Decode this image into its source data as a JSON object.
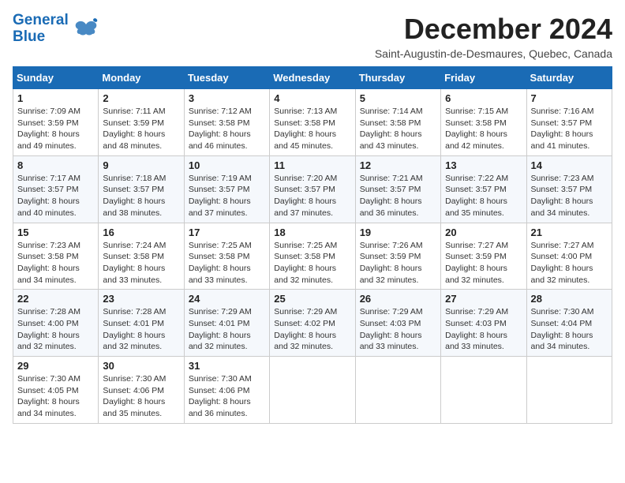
{
  "header": {
    "logo_line1": "General",
    "logo_line2": "Blue",
    "main_title": "December 2024",
    "subtitle": "Saint-Augustin-de-Desmaures, Quebec, Canada"
  },
  "days_of_week": [
    "Sunday",
    "Monday",
    "Tuesday",
    "Wednesday",
    "Thursday",
    "Friday",
    "Saturday"
  ],
  "weeks": [
    [
      {
        "day": "1",
        "sunrise": "7:09 AM",
        "sunset": "3:59 PM",
        "daylight": "8 hours and 49 minutes."
      },
      {
        "day": "2",
        "sunrise": "7:11 AM",
        "sunset": "3:59 PM",
        "daylight": "8 hours and 48 minutes."
      },
      {
        "day": "3",
        "sunrise": "7:12 AM",
        "sunset": "3:58 PM",
        "daylight": "8 hours and 46 minutes."
      },
      {
        "day": "4",
        "sunrise": "7:13 AM",
        "sunset": "3:58 PM",
        "daylight": "8 hours and 45 minutes."
      },
      {
        "day": "5",
        "sunrise": "7:14 AM",
        "sunset": "3:58 PM",
        "daylight": "8 hours and 43 minutes."
      },
      {
        "day": "6",
        "sunrise": "7:15 AM",
        "sunset": "3:58 PM",
        "daylight": "8 hours and 42 minutes."
      },
      {
        "day": "7",
        "sunrise": "7:16 AM",
        "sunset": "3:57 PM",
        "daylight": "8 hours and 41 minutes."
      }
    ],
    [
      {
        "day": "8",
        "sunrise": "7:17 AM",
        "sunset": "3:57 PM",
        "daylight": "8 hours and 40 minutes."
      },
      {
        "day": "9",
        "sunrise": "7:18 AM",
        "sunset": "3:57 PM",
        "daylight": "8 hours and 38 minutes."
      },
      {
        "day": "10",
        "sunrise": "7:19 AM",
        "sunset": "3:57 PM",
        "daylight": "8 hours and 37 minutes."
      },
      {
        "day": "11",
        "sunrise": "7:20 AM",
        "sunset": "3:57 PM",
        "daylight": "8 hours and 37 minutes."
      },
      {
        "day": "12",
        "sunrise": "7:21 AM",
        "sunset": "3:57 PM",
        "daylight": "8 hours and 36 minutes."
      },
      {
        "day": "13",
        "sunrise": "7:22 AM",
        "sunset": "3:57 PM",
        "daylight": "8 hours and 35 minutes."
      },
      {
        "day": "14",
        "sunrise": "7:23 AM",
        "sunset": "3:57 PM",
        "daylight": "8 hours and 34 minutes."
      }
    ],
    [
      {
        "day": "15",
        "sunrise": "7:23 AM",
        "sunset": "3:58 PM",
        "daylight": "8 hours and 34 minutes."
      },
      {
        "day": "16",
        "sunrise": "7:24 AM",
        "sunset": "3:58 PM",
        "daylight": "8 hours and 33 minutes."
      },
      {
        "day": "17",
        "sunrise": "7:25 AM",
        "sunset": "3:58 PM",
        "daylight": "8 hours and 33 minutes."
      },
      {
        "day": "18",
        "sunrise": "7:25 AM",
        "sunset": "3:58 PM",
        "daylight": "8 hours and 32 minutes."
      },
      {
        "day": "19",
        "sunrise": "7:26 AM",
        "sunset": "3:59 PM",
        "daylight": "8 hours and 32 minutes."
      },
      {
        "day": "20",
        "sunrise": "7:27 AM",
        "sunset": "3:59 PM",
        "daylight": "8 hours and 32 minutes."
      },
      {
        "day": "21",
        "sunrise": "7:27 AM",
        "sunset": "4:00 PM",
        "daylight": "8 hours and 32 minutes."
      }
    ],
    [
      {
        "day": "22",
        "sunrise": "7:28 AM",
        "sunset": "4:00 PM",
        "daylight": "8 hours and 32 minutes."
      },
      {
        "day": "23",
        "sunrise": "7:28 AM",
        "sunset": "4:01 PM",
        "daylight": "8 hours and 32 minutes."
      },
      {
        "day": "24",
        "sunrise": "7:29 AM",
        "sunset": "4:01 PM",
        "daylight": "8 hours and 32 minutes."
      },
      {
        "day": "25",
        "sunrise": "7:29 AM",
        "sunset": "4:02 PM",
        "daylight": "8 hours and 32 minutes."
      },
      {
        "day": "26",
        "sunrise": "7:29 AM",
        "sunset": "4:03 PM",
        "daylight": "8 hours and 33 minutes."
      },
      {
        "day": "27",
        "sunrise": "7:29 AM",
        "sunset": "4:03 PM",
        "daylight": "8 hours and 33 minutes."
      },
      {
        "day": "28",
        "sunrise": "7:30 AM",
        "sunset": "4:04 PM",
        "daylight": "8 hours and 34 minutes."
      }
    ],
    [
      {
        "day": "29",
        "sunrise": "7:30 AM",
        "sunset": "4:05 PM",
        "daylight": "8 hours and 34 minutes."
      },
      {
        "day": "30",
        "sunrise": "7:30 AM",
        "sunset": "4:06 PM",
        "daylight": "8 hours and 35 minutes."
      },
      {
        "day": "31",
        "sunrise": "7:30 AM",
        "sunset": "4:06 PM",
        "daylight": "8 hours and 36 minutes."
      },
      null,
      null,
      null,
      null
    ]
  ]
}
